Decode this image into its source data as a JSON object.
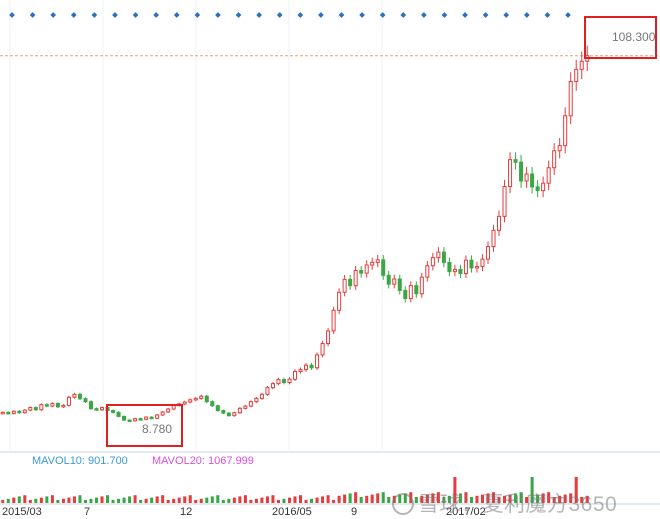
{
  "chart_data": {
    "type": "candlestick",
    "legend": {
      "mavol10": "MAVOL10: 901.700",
      "mavol20": "MAVOL20: 1067.999"
    },
    "x_ticks": [
      "2015/03",
      "7",
      "12",
      "2016/05",
      "9",
      "2017/02"
    ],
    "y_range": [
      4.0,
      118.0
    ],
    "annotations": {
      "high": {
        "label": "108.300",
        "value": 108.3
      },
      "low": {
        "label": "8.780",
        "value": 8.78
      }
    },
    "reference_line": 108.3,
    "series_closes": [
      11.5,
      11.2,
      11.8,
      11.4,
      12.1,
      12.8,
      12.2,
      13.6,
      13.2,
      13.9,
      13.0,
      13.4,
      15.6,
      16.4,
      15.2,
      14.4,
      12.5,
      12.2,
      12.8,
      12.0,
      11.5,
      10.4,
      9.4,
      9.2,
      9.8,
      9.6,
      10.2,
      9.9,
      10.8,
      11.6,
      12.4,
      13.4,
      13.8,
      14.3,
      14.9,
      15.3,
      15.9,
      14.4,
      13.3,
      12.0,
      11.3,
      10.6,
      11.4,
      12.6,
      13.2,
      14.4,
      15.3,
      16.4,
      18.2,
      19.3,
      20.4,
      19.6,
      20.5,
      22.6,
      23.1,
      24.3,
      23.6,
      27.1,
      30.2,
      33.6,
      39.2,
      44.1,
      47.6,
      45.9,
      50.0,
      49.3,
      51.5,
      52.2,
      52.9,
      48.7,
      46.3,
      47.7,
      44.6,
      42.4,
      45.9,
      43.7,
      48.2,
      51.3,
      53.5,
      55.0,
      52.2,
      49.7,
      50.3,
      49.2,
      52.8,
      50.7,
      51.1,
      53.1,
      56.5,
      60.9,
      64.7,
      72.8,
      80.1,
      79.4,
      74.3,
      76.2,
      72.7,
      71.7,
      73.7,
      77.9,
      82.5,
      83.9,
      92.0,
      101.3,
      104.6,
      106.8,
      108.3
    ],
    "markers_row_count": 28,
    "volume_spikes_at": [
      82,
      96,
      104
    ]
  }
}
